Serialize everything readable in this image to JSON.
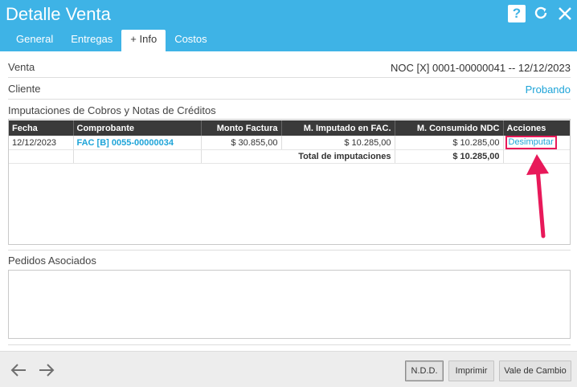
{
  "window": {
    "title": "Detalle Venta"
  },
  "header_icons": [
    "help-icon",
    "refresh-icon",
    "close-icon"
  ],
  "tabs": [
    {
      "label": "General",
      "active": false
    },
    {
      "label": "Entregas",
      "active": false
    },
    {
      "label": "+ Info",
      "active": true
    },
    {
      "label": "Costos",
      "active": false
    }
  ],
  "venta": {
    "label": "Venta",
    "value": "NOC [X] 0001-00000041 -- 12/12/2023"
  },
  "cliente": {
    "label": "Cliente",
    "value": "Probando"
  },
  "imputaciones": {
    "title": "Imputaciones de Cobros y Notas de Créditos",
    "columns": [
      "Fecha",
      "Comprobante",
      "Monto Factura",
      "M. Imputado en FAC.",
      "M. Consumido NDC",
      "Acciones"
    ],
    "rows": [
      {
        "fecha": "12/12/2023",
        "comprobante": "FAC [B] 0055-00000034",
        "monto_factura": "$ 30.855,00",
        "imputado": "$ 10.285,00",
        "consumido": "$ 10.285,00",
        "accion": "Desimputar"
      }
    ],
    "total_label": "Total de imputaciones",
    "total_value": "$ 10.285,00"
  },
  "pedidos": {
    "title": "Pedidos Asociados"
  },
  "footer": {
    "nav_icons": [
      "arrow-left-icon",
      "arrow-right-icon"
    ],
    "buttons": {
      "ndd": "N.D.D.",
      "imprimir": "Imprimir",
      "vale": "Vale de Cambio"
    }
  },
  "colors": {
    "header": "#3eb3e6",
    "link": "#1ea4d8",
    "highlight": "#e8195a"
  }
}
